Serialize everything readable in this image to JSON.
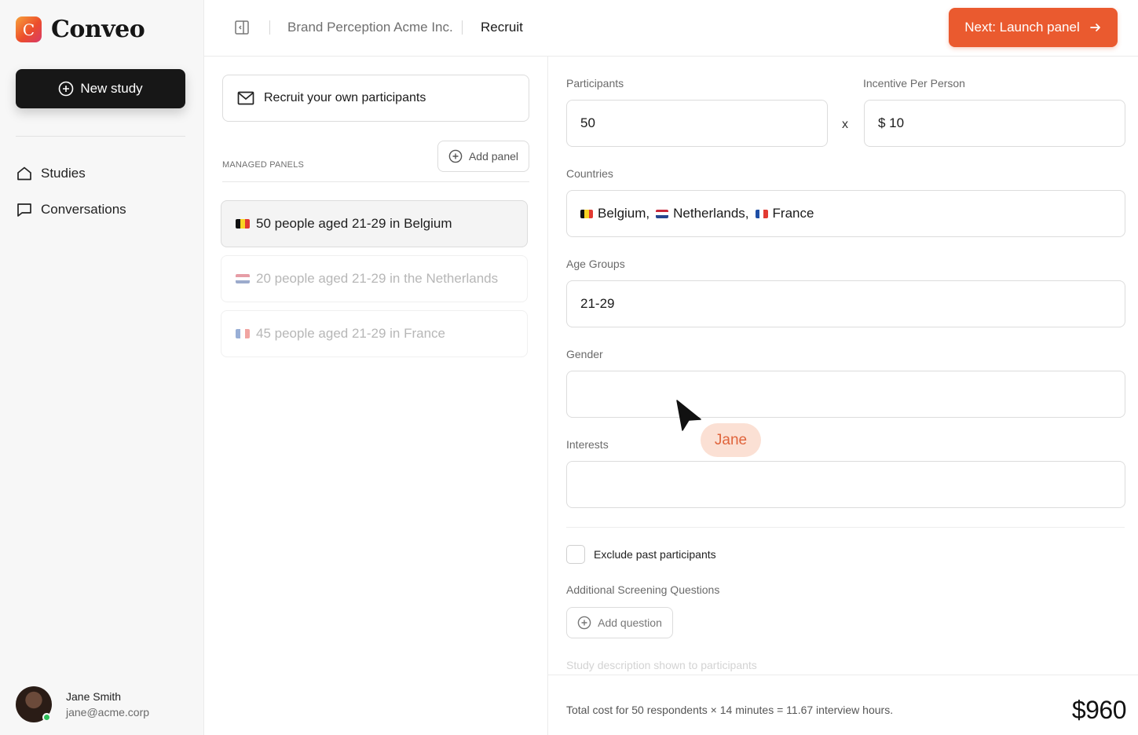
{
  "app": {
    "name": "Conveo",
    "logo_letter": "C",
    "accent": "#EA5A2F"
  },
  "sidebar": {
    "new_study_label": "New study",
    "items": [
      {
        "label": "Studies",
        "icon": "home-icon"
      },
      {
        "label": "Conversations",
        "icon": "chat-icon"
      }
    ],
    "user": {
      "name": "Jane Smith",
      "email": "jane@acme.corp",
      "status_color": "#2EC05A"
    }
  },
  "header": {
    "breadcrumb": [
      "Brand Perception Acme Inc.",
      "Recruit"
    ],
    "next_label": "Next: Launch panel"
  },
  "recruit": {
    "own_label": "Recruit your own participants",
    "managed_label": "MANAGED PANELS",
    "add_panel_label": "Add panel",
    "panels": [
      {
        "label": "50 people aged 21-29 in Belgium",
        "flag": "BE",
        "state": "active"
      },
      {
        "label": "20 people aged 21-29 in the Netherlands",
        "flag": "NL",
        "state": "muted"
      },
      {
        "label": "45 people aged 21-29 in France",
        "flag": "FR",
        "state": "muted"
      }
    ]
  },
  "form": {
    "participants_label": "Participants",
    "participants_value": "50",
    "times": "x",
    "incentive_label": "Incentive Per Person",
    "incentive_value": "$ 10",
    "countries_label": "Countries",
    "countries": [
      {
        "name": "Belgium,",
        "flag": "BE"
      },
      {
        "name": "Netherlands,",
        "flag": "NL"
      },
      {
        "name": "France",
        "flag": "FR"
      }
    ],
    "age_label": "Age Groups",
    "age_value": "21-29",
    "gender_label": "Gender",
    "gender_value": "",
    "interests_label": "Interests",
    "interests_value": "",
    "exclude_label": "Exclude past participants",
    "exclude_checked": false,
    "screening_label": "Additional Screening Questions",
    "add_question_label": "Add question",
    "description_label": "Study description shown to participants"
  },
  "footer": {
    "summary": "Total cost for 50 respondents × 14 minutes = 11.67 interview hours.",
    "total": "$960"
  },
  "cursor": {
    "user": "Jane"
  }
}
